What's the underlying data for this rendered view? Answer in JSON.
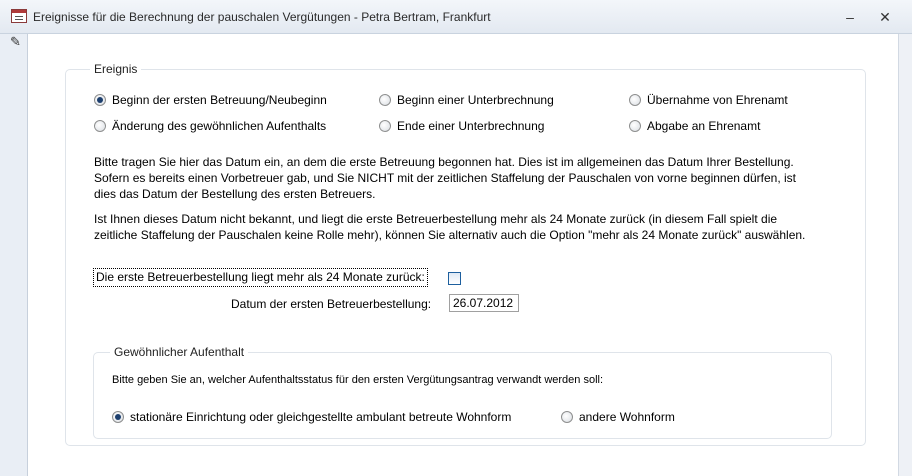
{
  "window": {
    "title": "Ereignisse für die Berechnung der pauschalen Vergütungen - Petra Bertram, Frankfurt",
    "minimize": "–",
    "restore": "□",
    "close": "✕"
  },
  "ereignis": {
    "legend": "Ereignis",
    "options": [
      {
        "label": "Beginn der ersten Betreuung/Neubeginn",
        "selected": true
      },
      {
        "label": "Beginn einer Unterbrechnung",
        "selected": false
      },
      {
        "label": "Übernahme von Ehrenamt",
        "selected": false
      },
      {
        "label": "Änderung des gewöhnlichen Aufenthalts",
        "selected": false
      },
      {
        "label": "Ende einer Unterbrechnung",
        "selected": false
      },
      {
        "label": "Abgabe an Ehrenamt",
        "selected": false
      }
    ],
    "paragraph1": [
      "Bitte tragen Sie hier das Datum ein, an dem die erste Betreuung begonnen hat. Dies ist im allgemeinen das Datum Ihrer Bestellung.",
      "Sofern es bereits einen Vorbetreuer gab, und Sie NICHT mit der zeitlichen Staffelung der Pauschalen von vorne beginnen dürfen, ist",
      "dies das Datum der Bestellung des ersten Betreuers."
    ],
    "paragraph2": [
      "Ist Ihnen dieses Datum nicht bekannt, und liegt die erste Betreuerbestellung mehr als 24 Monate zurück (in diesem Fall spielt die",
      "zeitliche Staffelung der Pauschalen keine Rolle mehr), können Sie alternativ auch die Option \"mehr als 24 Monate zurück\" auswählen."
    ],
    "checkbox_label": "Die erste Betreuerbestellung liegt mehr als 24 Monate zurück:",
    "checkbox_checked": false,
    "date_label": "Datum der ersten Betreuerbestellung:",
    "date_value": "26.07.2012"
  },
  "aufenthalt": {
    "legend": "Gewöhnlicher Aufenthalt",
    "prompt": "Bitte geben Sie an, welcher Aufenthaltsstatus für den ersten Vergütungsantrag verwandt werden soll:",
    "options": [
      {
        "label": "stationäre Einrichtung oder gleichgestellte ambulant betreute Wohnform",
        "selected": true
      },
      {
        "label": "andere Wohnform",
        "selected": false
      }
    ]
  },
  "icons": {
    "app": "form-icon",
    "record_selector": "pencil-icon"
  }
}
